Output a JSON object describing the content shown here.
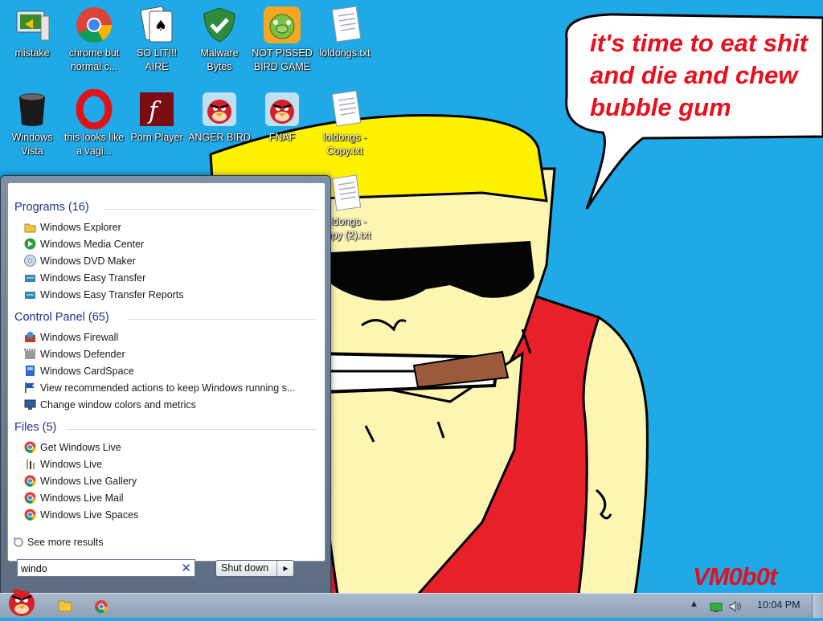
{
  "desktop": {
    "icons": [
      {
        "label": "mistake",
        "icon": "monitor-icon"
      },
      {
        "label": "chrome but normal c...",
        "icon": "chrome-icon"
      },
      {
        "label": "SO LIT!!! AIRE",
        "icon": "solitaire-icon"
      },
      {
        "label": "Malware Bytes",
        "icon": "shield-icon"
      },
      {
        "label": "NOT PISSED BIRD GAME",
        "icon": "pig-icon"
      },
      {
        "label": "loldongs.txt",
        "icon": "text-file-icon"
      },
      {
        "label": "Windows Vista",
        "icon": "trash-can-icon"
      },
      {
        "label": "this looks like a vagi...",
        "icon": "opera-icon"
      },
      {
        "label": "Porn Player",
        "icon": "flash-icon"
      },
      {
        "label": "ANGER BIRD",
        "icon": "angry-bird-icon"
      },
      {
        "label": "FNAF",
        "icon": "angry-bird-icon"
      },
      {
        "label": "loldongs - Copy.txt",
        "icon": "text-file-icon"
      },
      {
        "label": "loldongs - Copy (2).txt",
        "icon": "text-file-icon"
      }
    ]
  },
  "wallpaper": {
    "speech_lines": [
      "it's time to eat shit",
      "and die and chew",
      "bubble gum"
    ],
    "signature": "VM0b0t"
  },
  "start_menu": {
    "groups": [
      {
        "title": "Programs (16)",
        "items": [
          {
            "label": "Windows Explorer",
            "icon": "folder-icon"
          },
          {
            "label": "Windows Media Center",
            "icon": "media-center-icon"
          },
          {
            "label": "Windows DVD Maker",
            "icon": "dvd-icon"
          },
          {
            "label": "Windows Easy Transfer",
            "icon": "transfer-icon"
          },
          {
            "label": "Windows Easy Transfer Reports",
            "icon": "transfer-icon"
          }
        ]
      },
      {
        "title": "Control Panel (65)",
        "items": [
          {
            "label": "Windows Firewall",
            "icon": "firewall-icon"
          },
          {
            "label": "Windows Defender",
            "icon": "defender-icon"
          },
          {
            "label": "Windows CardSpace",
            "icon": "cardspace-icon"
          },
          {
            "label": "View recommended actions to keep Windows running s...",
            "icon": "flag-icon"
          },
          {
            "label": "Change window colors and metrics",
            "icon": "display-icon"
          }
        ]
      },
      {
        "title": "Files (5)",
        "items": [
          {
            "label": "Get Windows Live",
            "icon": "chrome-icon"
          },
          {
            "label": "Windows Live",
            "icon": "bars-icon"
          },
          {
            "label": "Windows Live Gallery",
            "icon": "chrome-icon"
          },
          {
            "label": "Windows Live Mail",
            "icon": "chrome-icon"
          },
          {
            "label": "Windows Live Spaces",
            "icon": "chrome-icon"
          }
        ]
      }
    ],
    "see_more": "See more results",
    "search_value": "windo",
    "shutdown_label": "Shut down"
  },
  "taskbar": {
    "clock": "10:04 PM",
    "tray_icons": [
      "network-icon",
      "volume-icon"
    ]
  }
}
